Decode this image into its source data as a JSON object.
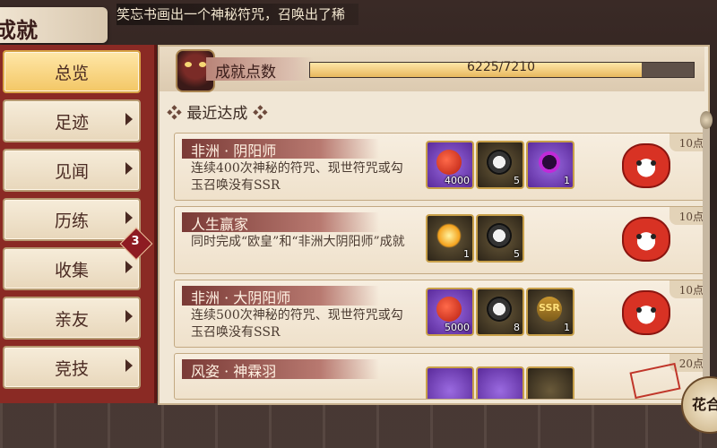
{
  "header": {
    "title": "成就"
  },
  "marquee": {
    "text": "笑忘书画出一个神秘符咒，召唤出了稀"
  },
  "nav": {
    "items": [
      {
        "label": "总览",
        "active": true
      },
      {
        "label": "足迹"
      },
      {
        "label": "见闻"
      },
      {
        "label": "历练"
      },
      {
        "label": "收集",
        "badge": "3"
      },
      {
        "label": "亲友"
      },
      {
        "label": "竞技"
      }
    ]
  },
  "points": {
    "label": "成就点数",
    "current": 6225,
    "total": 7210,
    "text": "6225/7210",
    "fraction": 0.8634
  },
  "section": {
    "title": "最近达成",
    "decor": "❖"
  },
  "achievements": [
    {
      "name": "非洲 · 阴阳师",
      "desc": "连续400次神秘的符咒、现世符咒或勾玉召唤没有SSR",
      "points": "10点",
      "rewards": [
        {
          "icon": "red-bean-icon",
          "qty": "4000"
        },
        {
          "icon": "daruma-icon",
          "qty": "5"
        },
        {
          "icon": "dark-orb-icon",
          "qty": "1"
        }
      ]
    },
    {
      "name": "人生赢家",
      "desc": "同时完成“欧皇”和“非洲大阴阳师”成就",
      "points": "10点",
      "rewards": [
        {
          "icon": "sun-orb-icon",
          "qty": "1"
        },
        {
          "icon": "daruma-icon",
          "qty": "5"
        }
      ]
    },
    {
      "name": "非洲 · 大阴阳师",
      "desc": "连续500次神秘的符咒、现世符咒或勾玉召唤没有SSR",
      "points": "10点",
      "rewards": [
        {
          "icon": "red-bean-icon",
          "qty": "5000"
        },
        {
          "icon": "daruma-icon",
          "qty": "8"
        },
        {
          "icon": "ssr-ticket-icon",
          "qty": "1",
          "label": "SSR"
        }
      ]
    },
    {
      "name": "风姿 · 神霖羽",
      "desc": "",
      "points": "20点",
      "rewards": []
    }
  ],
  "decor": {
    "corner_label": "花合"
  }
}
